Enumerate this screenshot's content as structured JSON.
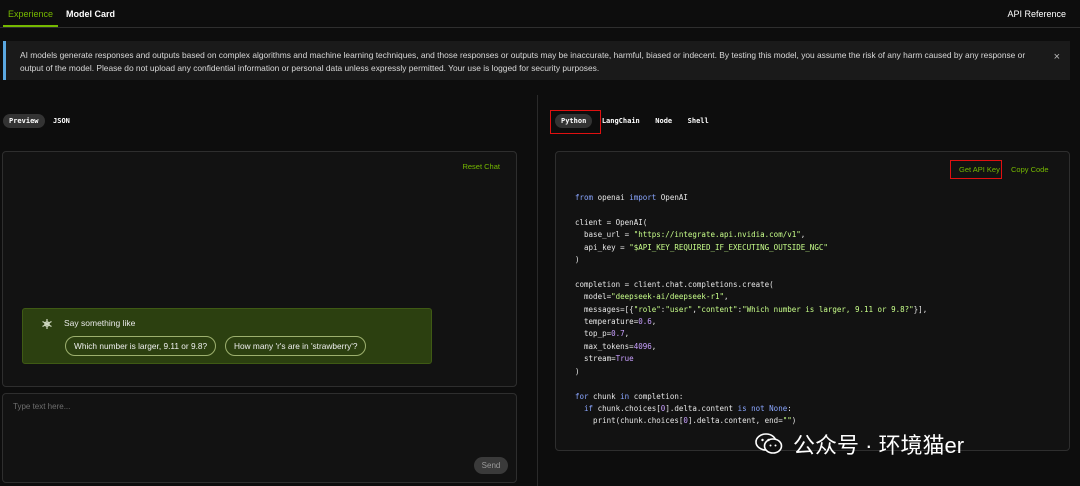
{
  "header": {
    "tabs": [
      {
        "label": "Experience",
        "active": true
      },
      {
        "label": "Model Card",
        "active": false
      }
    ],
    "api_reference": "API Reference"
  },
  "banner": {
    "text": "AI models generate responses and outputs based on complex algorithms and machine learning techniques, and those responses or outputs may be inaccurate, harmful, biased or indecent. By testing this model, you assume the risk of any harm caused by any response or output of the model. Please do not upload any confidential information or personal data unless expressly permitted. Your use is logged for security purposes.",
    "close_icon": "×"
  },
  "left": {
    "tabs": [
      {
        "label": "Preview",
        "active": true
      },
      {
        "label": "JSON",
        "active": false
      }
    ],
    "reset_chat": "Reset Chat",
    "suggestions": {
      "title": "Say something like",
      "chips": [
        "Which number is larger, 9.11 or 9.8?",
        "How many 'r's are in 'strawberry'?"
      ]
    },
    "input": {
      "placeholder": "Type text here...",
      "send_label": "Send"
    }
  },
  "right": {
    "tabs": [
      {
        "label": "Python",
        "active": true
      },
      {
        "label": "LangChain",
        "active": false
      },
      {
        "label": "Node",
        "active": false
      },
      {
        "label": "Shell",
        "active": false
      }
    ],
    "get_api_key": "Get API Key",
    "copy_code": "Copy Code",
    "code": {
      "l1_from": "from",
      "l1_mod": " openai ",
      "l1_import": "import",
      "l1_name": " OpenAI",
      "l2": "client = OpenAI(",
      "l3_a": "  base_url = ",
      "l3_s": "\"https://integrate.api.nvidia.com/v1\"",
      "l3_b": ",",
      "l4_a": "  api_key = ",
      "l4_s": "\"$API_KEY_REQUIRED_IF_EXECUTING_OUTSIDE_NGC\"",
      "l5": ")",
      "l6": "completion = client.chat.completions.create(",
      "l7_a": "  model=",
      "l7_s": "\"deepseek-ai/deepseek-r1\"",
      "l7_b": ",",
      "l8_a": "  messages=[{",
      "l8_s1": "\"role\"",
      "l8_c1": ":",
      "l8_s2": "\"user\"",
      "l8_c2": ",",
      "l8_s3": "\"content\"",
      "l8_c3": ":",
      "l8_s4": "\"Which number is larger, 9.11 or 9.8?\"",
      "l8_b": "}],",
      "l9_a": "  temperature=",
      "l9_n": "0.6",
      "l9_b": ",",
      "l10_a": "  top_p=",
      "l10_n": "0.7",
      "l10_b": ",",
      "l11_a": "  max_tokens=",
      "l11_n": "4096",
      "l11_b": ",",
      "l12_a": "  stream=",
      "l12_n": "True",
      "l13": ")",
      "l14_for": "for",
      "l14_a": " chunk ",
      "l14_in": "in",
      "l14_b": " completion:",
      "l15_if": "  if",
      "l15_a": " chunk.choices[",
      "l15_n0": "0",
      "l15_b": "].delta.content ",
      "l15_isnot": "is not",
      "l15_none": " None",
      "l15_c": ":",
      "l16_a": "    print(chunk.choices[",
      "l16_n0": "0",
      "l16_b": "].delta.content, end=",
      "l16_s": "\"\"",
      "l16_c": ")"
    }
  },
  "watermark": {
    "icon": "wechat-icon",
    "text": "公众号 · 环境猫er"
  },
  "colors": {
    "accent": "#76b900",
    "background": "#0d0d0d",
    "suggest_bg": "#2c4010",
    "highlight_box": "#e01010",
    "banner_stripe": "#5aa7e0"
  }
}
